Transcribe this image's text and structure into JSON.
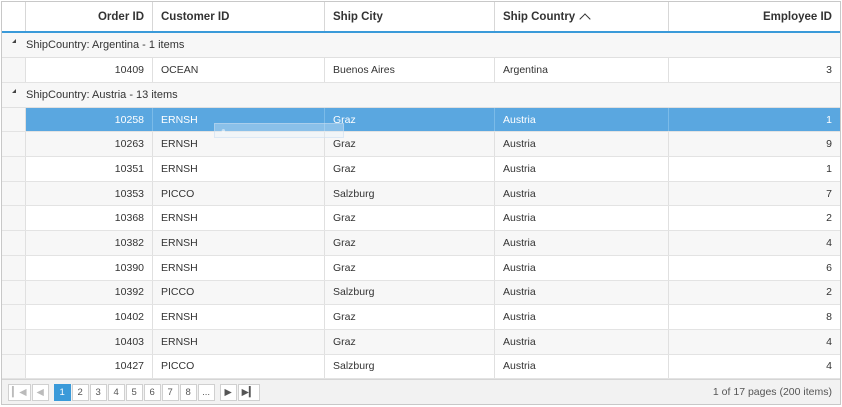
{
  "columns": {
    "order_id": "Order ID",
    "customer_id": "Customer ID",
    "ship_city": "Ship City",
    "ship_country": "Ship Country",
    "employee_id": "Employee ID"
  },
  "groups": [
    {
      "caption": "ShipCountry: Argentina - 1 items",
      "rows": [
        {
          "order_id": "10409",
          "customer_id": "OCEAN",
          "ship_city": "Buenos Aires",
          "ship_country": "Argentina",
          "employee_id": "3"
        }
      ]
    },
    {
      "caption": "ShipCountry: Austria - 13 items",
      "rows": [
        {
          "order_id": "10258",
          "customer_id": "ERNSH",
          "ship_city": "Graz",
          "ship_country": "Austria",
          "employee_id": "1"
        },
        {
          "order_id": "10263",
          "customer_id": "ERNSH",
          "ship_city": "Graz",
          "ship_country": "Austria",
          "employee_id": "9"
        },
        {
          "order_id": "10351",
          "customer_id": "ERNSH",
          "ship_city": "Graz",
          "ship_country": "Austria",
          "employee_id": "1"
        },
        {
          "order_id": "10353",
          "customer_id": "PICCO",
          "ship_city": "Salzburg",
          "ship_country": "Austria",
          "employee_id": "7"
        },
        {
          "order_id": "10368",
          "customer_id": "ERNSH",
          "ship_city": "Graz",
          "ship_country": "Austria",
          "employee_id": "2"
        },
        {
          "order_id": "10382",
          "customer_id": "ERNSH",
          "ship_city": "Graz",
          "ship_country": "Austria",
          "employee_id": "4"
        },
        {
          "order_id": "10390",
          "customer_id": "ERNSH",
          "ship_city": "Graz",
          "ship_country": "Austria",
          "employee_id": "6"
        },
        {
          "order_id": "10392",
          "customer_id": "PICCO",
          "ship_city": "Salzburg",
          "ship_country": "Austria",
          "employee_id": "2"
        },
        {
          "order_id": "10402",
          "customer_id": "ERNSH",
          "ship_city": "Graz",
          "ship_country": "Austria",
          "employee_id": "8"
        },
        {
          "order_id": "10403",
          "customer_id": "ERNSH",
          "ship_city": "Graz",
          "ship_country": "Austria",
          "employee_id": "4"
        },
        {
          "order_id": "10427",
          "customer_id": "PICCO",
          "ship_city": "Salzburg",
          "ship_country": "Austria",
          "employee_id": "4"
        }
      ]
    }
  ],
  "pager": {
    "first_icon": "first-page-icon",
    "prev_icon": "prev-page-icon",
    "next_icon": "next-page-icon",
    "last_icon": "last-page-icon",
    "pages": [
      "1",
      "2",
      "3",
      "4",
      "5",
      "6",
      "7",
      "8",
      "..."
    ],
    "current_page": "1",
    "info": "1 of 17 pages (200 items)"
  },
  "colors": {
    "accent": "#3a9ad9",
    "selected_row": "#5aa7e0"
  }
}
